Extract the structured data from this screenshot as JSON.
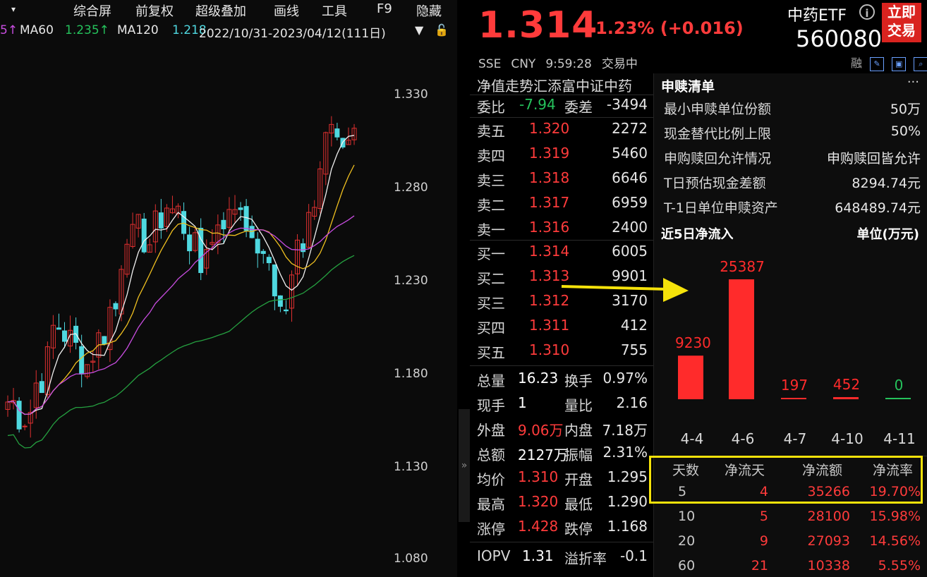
{
  "toolbar": {
    "items": [
      "综合屏",
      "前复权",
      "超级叠加",
      "画线",
      "工具",
      "F9",
      "隐藏"
    ]
  },
  "ma_row": {
    "ma5_arrow": "5↑",
    "ma60_label": "MA60",
    "ma60_value": "1.235↑",
    "ma120_label": "MA120",
    "ma120_value": "1.218",
    "date_range": "2022/10/31-2023/04/12(111日)"
  },
  "price_axis": [
    "1.330",
    "1.280",
    "1.230",
    "1.180",
    "1.130",
    "1.080"
  ],
  "quote": {
    "price": "1.314",
    "change": "+1.23% (+0.016)",
    "name": "中药ETF",
    "info_icon": "i",
    "code": "560080",
    "trade_btn_line1": "立即",
    "trade_btn_line2": "交易",
    "exchange": "SSE",
    "currency": "CNY",
    "time": "9:59:28",
    "status": "交易中",
    "rong": "融"
  },
  "book": {
    "header": "净值走势汇添富中证中药",
    "weibi_label": "委比",
    "weibi_value": "-7.94",
    "weicha_label": "委差",
    "weicha_value": "-3494",
    "asks": [
      {
        "label": "卖五",
        "price": "1.320",
        "vol": "2272"
      },
      {
        "label": "卖四",
        "price": "1.319",
        "vol": "5460"
      },
      {
        "label": "卖三",
        "price": "1.318",
        "vol": "6646"
      },
      {
        "label": "卖二",
        "price": "1.317",
        "vol": "6959"
      },
      {
        "label": "卖一",
        "price": "1.316",
        "vol": "2400"
      }
    ],
    "bids": [
      {
        "label": "买一",
        "price": "1.314",
        "vol": "6005"
      },
      {
        "label": "买二",
        "price": "1.313",
        "vol": "9901"
      },
      {
        "label": "买三",
        "price": "1.312",
        "vol": "3170"
      },
      {
        "label": "买四",
        "price": "1.311",
        "vol": "412"
      },
      {
        "label": "买五",
        "price": "1.310",
        "vol": "755"
      }
    ],
    "stats": [
      {
        "l1": "总量",
        "v1": "16.23",
        "c1": "white",
        "l2": "换手",
        "v2": "0.97%",
        "c2": "white"
      },
      {
        "l1": "现手",
        "v1": "1",
        "c1": "white",
        "l2": "量比",
        "v2": "2.16",
        "c2": "white"
      },
      {
        "l1": "外盘",
        "v1": "9.06万",
        "c1": "red",
        "l2": "内盘",
        "v2": "7.18万",
        "c2": "green"
      },
      {
        "l1": "总额",
        "v1": "2127万",
        "c1": "white",
        "l2": "振幅",
        "v2": "2.31%",
        "c2": "white"
      },
      {
        "l1": "均价",
        "v1": "1.310",
        "c1": "red",
        "l2": "开盘",
        "v2": "1.295",
        "c2": "green"
      },
      {
        "l1": "最高",
        "v1": "1.320",
        "c1": "red",
        "l2": "最低",
        "v2": "1.290",
        "c2": "green"
      },
      {
        "l1": "涨停",
        "v1": "1.428",
        "c1": "red",
        "l2": "跌停",
        "v2": "1.168",
        "c2": "green"
      },
      {
        "l1": "IOPV",
        "v1": "1.31",
        "c1": "white",
        "l2": "溢折率",
        "v2": "-0.1",
        "c2": "green"
      }
    ]
  },
  "redeem": {
    "title": "申赎清单",
    "more": "···",
    "rows": [
      {
        "label": "最小申赎单位份额",
        "value": "50万"
      },
      {
        "label": "现金替代比例上限",
        "value": "50%"
      },
      {
        "label": "申购赎回允许情况",
        "value": "申购赎回皆允许"
      },
      {
        "label": "T日预估现金差额",
        "value": "8294.74元"
      },
      {
        "label": "T-1日单位申赎资产",
        "value": "648489.74元"
      }
    ],
    "flow_title": "近5日净流入",
    "flow_unit": "单位(万元)"
  },
  "chart_data": {
    "type": "bar",
    "categories": [
      "4-4",
      "4-6",
      "4-7",
      "4-10",
      "4-11"
    ],
    "values": [
      9230,
      25387,
      197,
      452,
      0
    ],
    "value_labels": [
      "9230",
      "25387",
      "197",
      "452",
      "0"
    ],
    "title": "近5日净流入",
    "ylabel": "单位(万元)",
    "colors": [
      "#ff2b2b",
      "#ff2b2b",
      "#ff2b2b",
      "#ff2b2b",
      "#25c25c"
    ]
  },
  "flow_table": {
    "headers": [
      "天数",
      "净流天",
      "净流额",
      "净流率"
    ],
    "rows": [
      [
        "5",
        "4",
        "35266",
        "19.70%"
      ],
      [
        "10",
        "5",
        "28100",
        "15.98%"
      ],
      [
        "20",
        "9",
        "27093",
        "14.56%"
      ],
      [
        "60",
        "21",
        "10338",
        "5.55%"
      ]
    ]
  },
  "colors": {
    "up": "#ff3b3b",
    "down": "#25c25c",
    "candle_down": "#4fd8e0",
    "highlight": "#f5e20a"
  }
}
